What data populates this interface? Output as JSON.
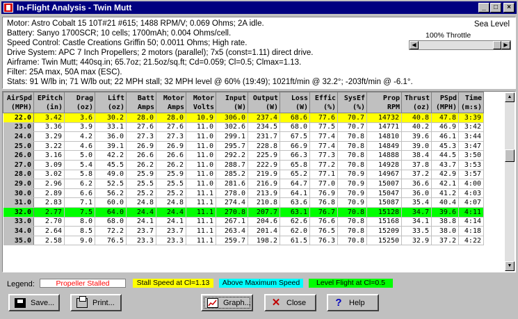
{
  "window": {
    "title": "In-Flight Analysis - Twin Mutt"
  },
  "info": {
    "lines": [
      "Motor: Astro Cobalt 15 10T#21 #615; 1488 RPM/V; 0.069 Ohms; 2A idle.",
      "Battery: Sanyo 1700SCR; 10 cells; 1700mAh; 0.004 Ohms/cell.",
      "Speed Control: Castle Creations Griffin 50; 0.0011 Ohms; High rate.",
      "Drive System: APC 7 Inch Propellers; 2 motors (parallel); 7x5 (const=1.11) direct drive.",
      "Airframe: Twin Mutt; 440sq.in; 65.7oz; 21.5oz/sq.ft; Cd=0.059; Cl=0.5; Clmax=1.13.",
      "Filter: 25A max, 50A max (ESC).",
      "Stats: 91 W/lb in; 71 W/lb out; 22 MPH stall; 32 MPH level @ 60% (19:49); 1021ft/min @ 32.2°; -203ft/min @ -6.1°."
    ],
    "sea_level": "Sea Level",
    "throttle_label": "100% Throttle",
    "throttle_percent": 100
  },
  "table": {
    "headers": [
      [
        "AirSpd",
        "(MPH)"
      ],
      [
        "EPitch",
        "(in)"
      ],
      [
        "Drag",
        "(oz)"
      ],
      [
        "Lift",
        "(oz)"
      ],
      [
        "Batt",
        "Amps"
      ],
      [
        "Motor",
        "Amps"
      ],
      [
        "Motor",
        "Volts"
      ],
      [
        "Input",
        "(W)"
      ],
      [
        "Output",
        "(W)"
      ],
      [
        "Loss",
        "(W)"
      ],
      [
        "Effic",
        "(%)"
      ],
      [
        "SysEf",
        "(%)"
      ],
      [
        "Prop",
        "RPM"
      ],
      [
        "Thrust",
        "(oz)"
      ],
      [
        "PSpd",
        "(MPH)"
      ],
      [
        "Time",
        "(m:s)"
      ]
    ],
    "rows": [
      {
        "style": "stall",
        "cells": [
          "22.0",
          "3.42",
          "3.6",
          "30.2",
          "28.0",
          "28.0",
          "10.9",
          "306.0",
          "237.4",
          "68.6",
          "77.6",
          "70.7",
          "14732",
          "40.8",
          "47.8",
          "3:39"
        ]
      },
      {
        "style": "",
        "cells": [
          "23.0",
          "3.36",
          "3.9",
          "33.1",
          "27.6",
          "27.6",
          "11.0",
          "302.6",
          "234.5",
          "68.0",
          "77.5",
          "70.7",
          "14771",
          "40.2",
          "46.9",
          "3:42"
        ]
      },
      {
        "style": "",
        "cells": [
          "24.0",
          "3.29",
          "4.2",
          "36.0",
          "27.3",
          "27.3",
          "11.0",
          "299.1",
          "231.7",
          "67.5",
          "77.4",
          "70.8",
          "14810",
          "39.6",
          "46.1",
          "3:44"
        ]
      },
      {
        "style": "",
        "cells": [
          "25.0",
          "3.22",
          "4.6",
          "39.1",
          "26.9",
          "26.9",
          "11.0",
          "295.7",
          "228.8",
          "66.9",
          "77.4",
          "70.8",
          "14849",
          "39.0",
          "45.3",
          "3:47"
        ]
      },
      {
        "style": "",
        "cells": [
          "26.0",
          "3.16",
          "5.0",
          "42.2",
          "26.6",
          "26.6",
          "11.0",
          "292.2",
          "225.9",
          "66.3",
          "77.3",
          "70.8",
          "14888",
          "38.4",
          "44.5",
          "3:50"
        ]
      },
      {
        "style": "",
        "cells": [
          "27.0",
          "3.09",
          "5.4",
          "45.5",
          "26.2",
          "26.2",
          "11.0",
          "288.7",
          "222.9",
          "65.8",
          "77.2",
          "70.8",
          "14928",
          "37.8",
          "43.7",
          "3:53"
        ]
      },
      {
        "style": "",
        "cells": [
          "28.0",
          "3.02",
          "5.8",
          "49.0",
          "25.9",
          "25.9",
          "11.0",
          "285.2",
          "219.9",
          "65.2",
          "77.1",
          "70.9",
          "14967",
          "37.2",
          "42.9",
          "3:57"
        ]
      },
      {
        "style": "",
        "cells": [
          "29.0",
          "2.96",
          "6.2",
          "52.5",
          "25.5",
          "25.5",
          "11.0",
          "281.6",
          "216.9",
          "64.7",
          "77.0",
          "70.9",
          "15007",
          "36.6",
          "42.1",
          "4:00"
        ]
      },
      {
        "style": "",
        "cells": [
          "30.0",
          "2.89",
          "6.6",
          "56.2",
          "25.2",
          "25.2",
          "11.1",
          "278.0",
          "213.9",
          "64.1",
          "76.9",
          "70.9",
          "15047",
          "36.0",
          "41.2",
          "4:03"
        ]
      },
      {
        "style": "",
        "cells": [
          "31.0",
          "2.83",
          "7.1",
          "60.0",
          "24.8",
          "24.8",
          "11.1",
          "274.4",
          "210.8",
          "63.6",
          "76.8",
          "70.9",
          "15087",
          "35.4",
          "40.4",
          "4:07"
        ]
      },
      {
        "style": "level",
        "cells": [
          "32.0",
          "2.77",
          "7.5",
          "64.0",
          "24.4",
          "24.4",
          "11.1",
          "270.8",
          "207.7",
          "63.1",
          "76.7",
          "70.8",
          "15128",
          "34.7",
          "39.6",
          "4:11"
        ]
      },
      {
        "style": "",
        "cells": [
          "33.0",
          "2.70",
          "8.0",
          "68.0",
          "24.1",
          "24.1",
          "11.1",
          "267.1",
          "204.6",
          "62.6",
          "76.6",
          "70.8",
          "15168",
          "34.1",
          "38.8",
          "4:14"
        ]
      },
      {
        "style": "",
        "cells": [
          "34.0",
          "2.64",
          "8.5",
          "72.2",
          "23.7",
          "23.7",
          "11.1",
          "263.4",
          "201.4",
          "62.0",
          "76.5",
          "70.8",
          "15209",
          "33.5",
          "38.0",
          "4:18"
        ]
      },
      {
        "style": "",
        "cells": [
          "35.0",
          "2.58",
          "9.0",
          "76.5",
          "23.3",
          "23.3",
          "11.1",
          "259.7",
          "198.2",
          "61.5",
          "76.3",
          "70.8",
          "15250",
          "32.9",
          "37.2",
          "4:22"
        ]
      }
    ]
  },
  "legend": {
    "label": "Legend:",
    "stalled": "Propeller Stalled",
    "stall_speed": "Stall Speed at Cl=1.13",
    "above_max": "Above Maximum Speed",
    "level": "Level Flight at Cl=0.5"
  },
  "buttons": {
    "save": "Save...",
    "print": "Print...",
    "graph": "Graph...",
    "close": "Close",
    "help": "Help"
  },
  "icons": {
    "save": "floppy-disk-icon",
    "print": "printer-icon",
    "graph": "graph-icon",
    "close": "close-x-icon",
    "help": "question-mark-icon"
  }
}
